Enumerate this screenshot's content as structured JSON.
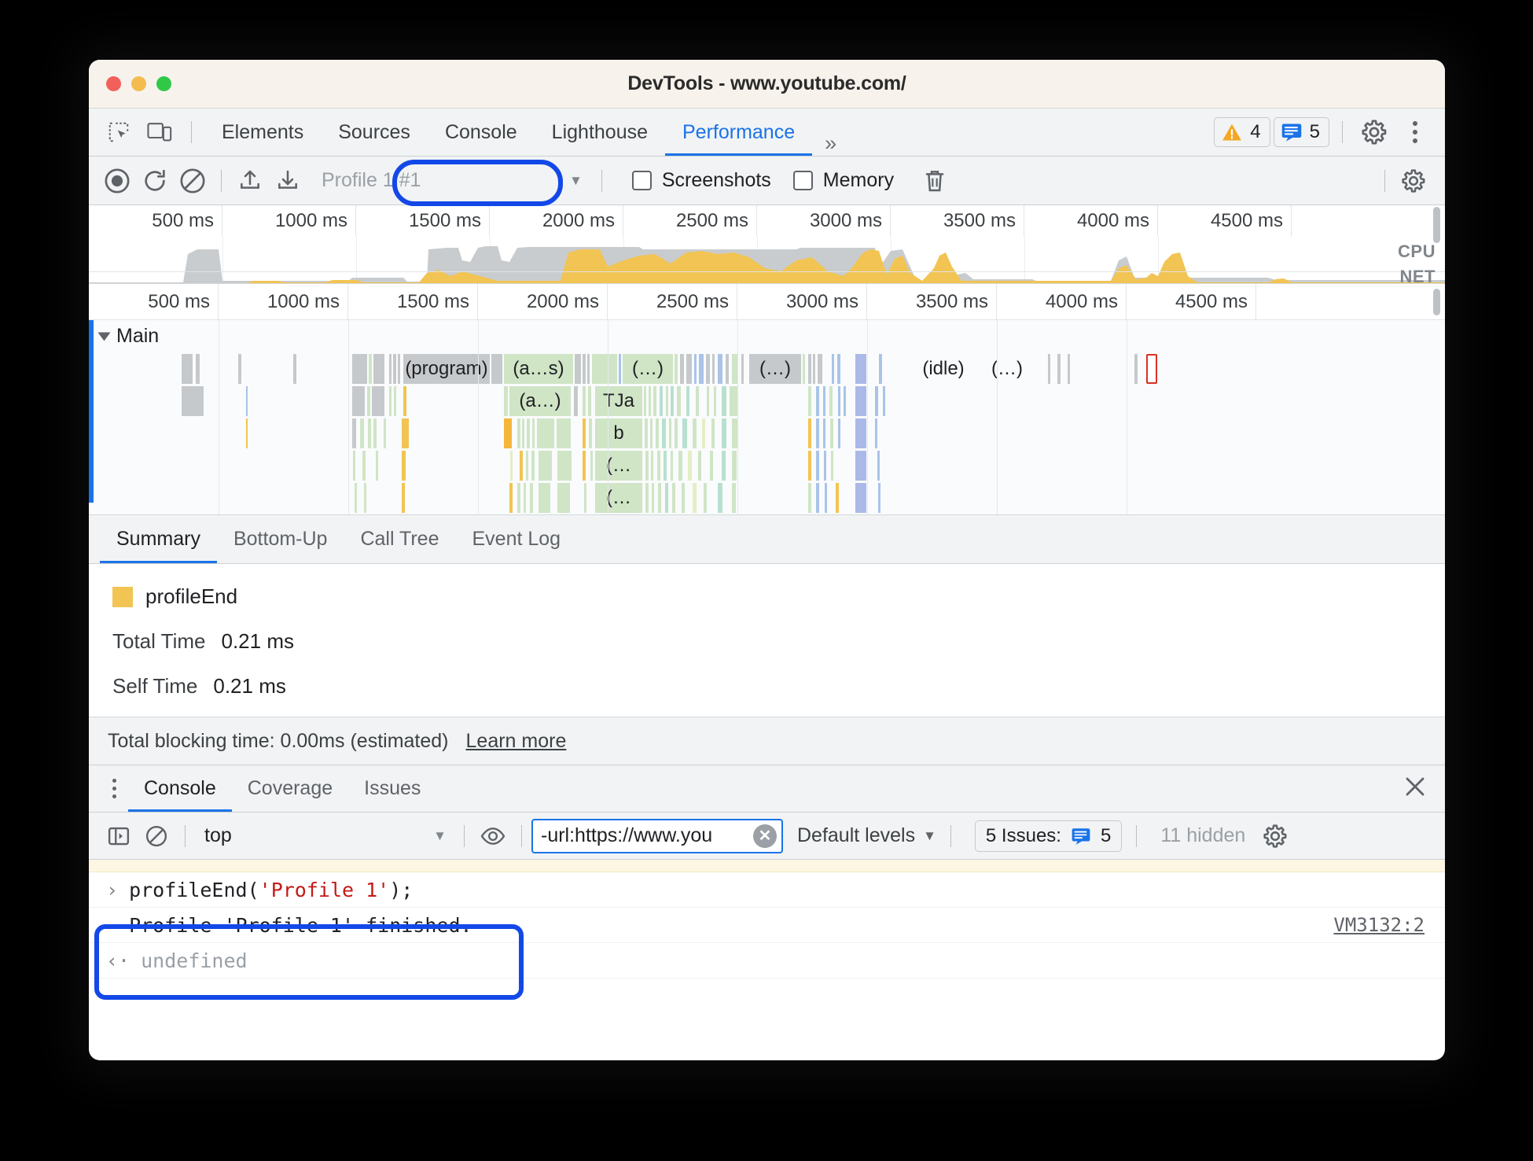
{
  "window": {
    "title": "DevTools - www.youtube.com/",
    "traffic_lights": [
      "close",
      "minimize",
      "zoom"
    ]
  },
  "main_tabbar": {
    "icons": [
      "inspect-element-icon",
      "device-toolbar-icon"
    ],
    "tabs": [
      {
        "label": "Elements",
        "active": false
      },
      {
        "label": "Sources",
        "active": false
      },
      {
        "label": "Console",
        "active": false
      },
      {
        "label": "Lighthouse",
        "active": false
      },
      {
        "label": "Performance",
        "active": true
      }
    ],
    "more_tabs": "»",
    "warning_badge": {
      "icon": "warning-triangle-icon",
      "count": "4"
    },
    "message_badge": {
      "icon": "message-icon",
      "count": "5"
    },
    "settings_icon": "gear-icon",
    "more_icon": "kebab-menu-icon"
  },
  "perf_toolbar": {
    "record_icon": "record-circle-icon",
    "reload_icon": "reload-record-icon",
    "clear_icon": "clear-icon",
    "load_icon": "upload-profile-icon",
    "save_icon": "download-profile-icon",
    "profile_selector_value": "Profile 1 #1",
    "profile_caret": "▼",
    "screenshots": {
      "label": "Screenshots",
      "checked": false
    },
    "memory": {
      "label": "Memory",
      "checked": false
    },
    "trash_icon": "trash-icon",
    "capture_settings_icon": "gear-icon"
  },
  "overview": {
    "ticks": [
      "500 ms",
      "1000 ms",
      "1500 ms",
      "2000 ms",
      "2500 ms",
      "3000 ms",
      "3500 ms",
      "4000 ms",
      "4500 ms"
    ],
    "cpu_label": "CPU",
    "net_label": "NET"
  },
  "flame": {
    "ticks": [
      "500 ms",
      "1000 ms",
      "1500 ms",
      "2000 ms",
      "2500 ms",
      "3000 ms",
      "3500 ms",
      "4000 ms",
      "4500 ms"
    ],
    "track_name": "Main",
    "track_expand_icon": "triangle-down-icon",
    "labeled_bars": [
      {
        "label": "(program)",
        "row": 0
      },
      {
        "label": "(a…s)",
        "row": 0
      },
      {
        "label": "(…)",
        "row": 0
      },
      {
        "label": "(…)",
        "row": 0
      },
      {
        "label": "(idle)",
        "row": 0
      },
      {
        "label": "(…)",
        "row": 0
      },
      {
        "label": "(a…)",
        "row": 1
      },
      {
        "label": "TJa",
        "row": 1
      },
      {
        "label": "b",
        "row": 2
      },
      {
        "label": "(…",
        "row": 3
      },
      {
        "label": "(…",
        "row": 4
      }
    ]
  },
  "summary_tabs": [
    {
      "label": "Summary",
      "active": true
    },
    {
      "label": "Bottom-Up",
      "active": false
    },
    {
      "label": "Call Tree",
      "active": false
    },
    {
      "label": "Event Log",
      "active": false
    }
  ],
  "summary": {
    "event_color": "#f1c453",
    "event_name": "profileEnd",
    "stats": [
      {
        "label": "Total Time",
        "value": "0.21 ms"
      },
      {
        "label": "Self Time",
        "value": "0.21 ms"
      }
    ],
    "tbt_text": "Total blocking time: 0.00ms (estimated)",
    "tbt_link": "Learn more"
  },
  "drawer": {
    "kebab_icon": "kebab-menu-icon",
    "tabs": [
      {
        "label": "Console",
        "active": true
      },
      {
        "label": "Coverage",
        "active": false
      },
      {
        "label": "Issues",
        "active": false
      }
    ],
    "close_icon": "close-icon"
  },
  "console_toolbar": {
    "sidebar_icon": "console-sidebar-icon",
    "clear_icon": "clear-console-icon",
    "context_value": "top",
    "context_caret": "▼",
    "eye_icon": "live-expression-icon",
    "filter_value": "-url:https://www.you",
    "filter_clear_icon": "clear-input-icon",
    "levels_label": "Default levels",
    "levels_caret": "▼",
    "issues_label": "5 Issues:",
    "issues_icon": "message-icon",
    "issues_count": "5",
    "hidden_label": "11 hidden",
    "settings_icon": "gear-icon"
  },
  "console_output": {
    "warning_row_clipped": "",
    "entries": [
      {
        "type": "input",
        "prompt": "›",
        "code_prefix": "profileEnd(",
        "code_string": "'Profile 1'",
        "code_suffix": ");",
        "source": ""
      },
      {
        "type": "log",
        "prompt": "",
        "text": "Profile 'Profile 1' finished.",
        "source": "VM3132:2"
      },
      {
        "type": "result",
        "prompt": "‹·",
        "text": "undefined",
        "source": ""
      }
    ]
  },
  "annotations": {
    "accent_color": "#1348e8",
    "items": [
      {
        "target": "profile-selector",
        "shape": "pill"
      },
      {
        "target": "console-profile-end-output",
        "shape": "rounded"
      }
    ]
  }
}
